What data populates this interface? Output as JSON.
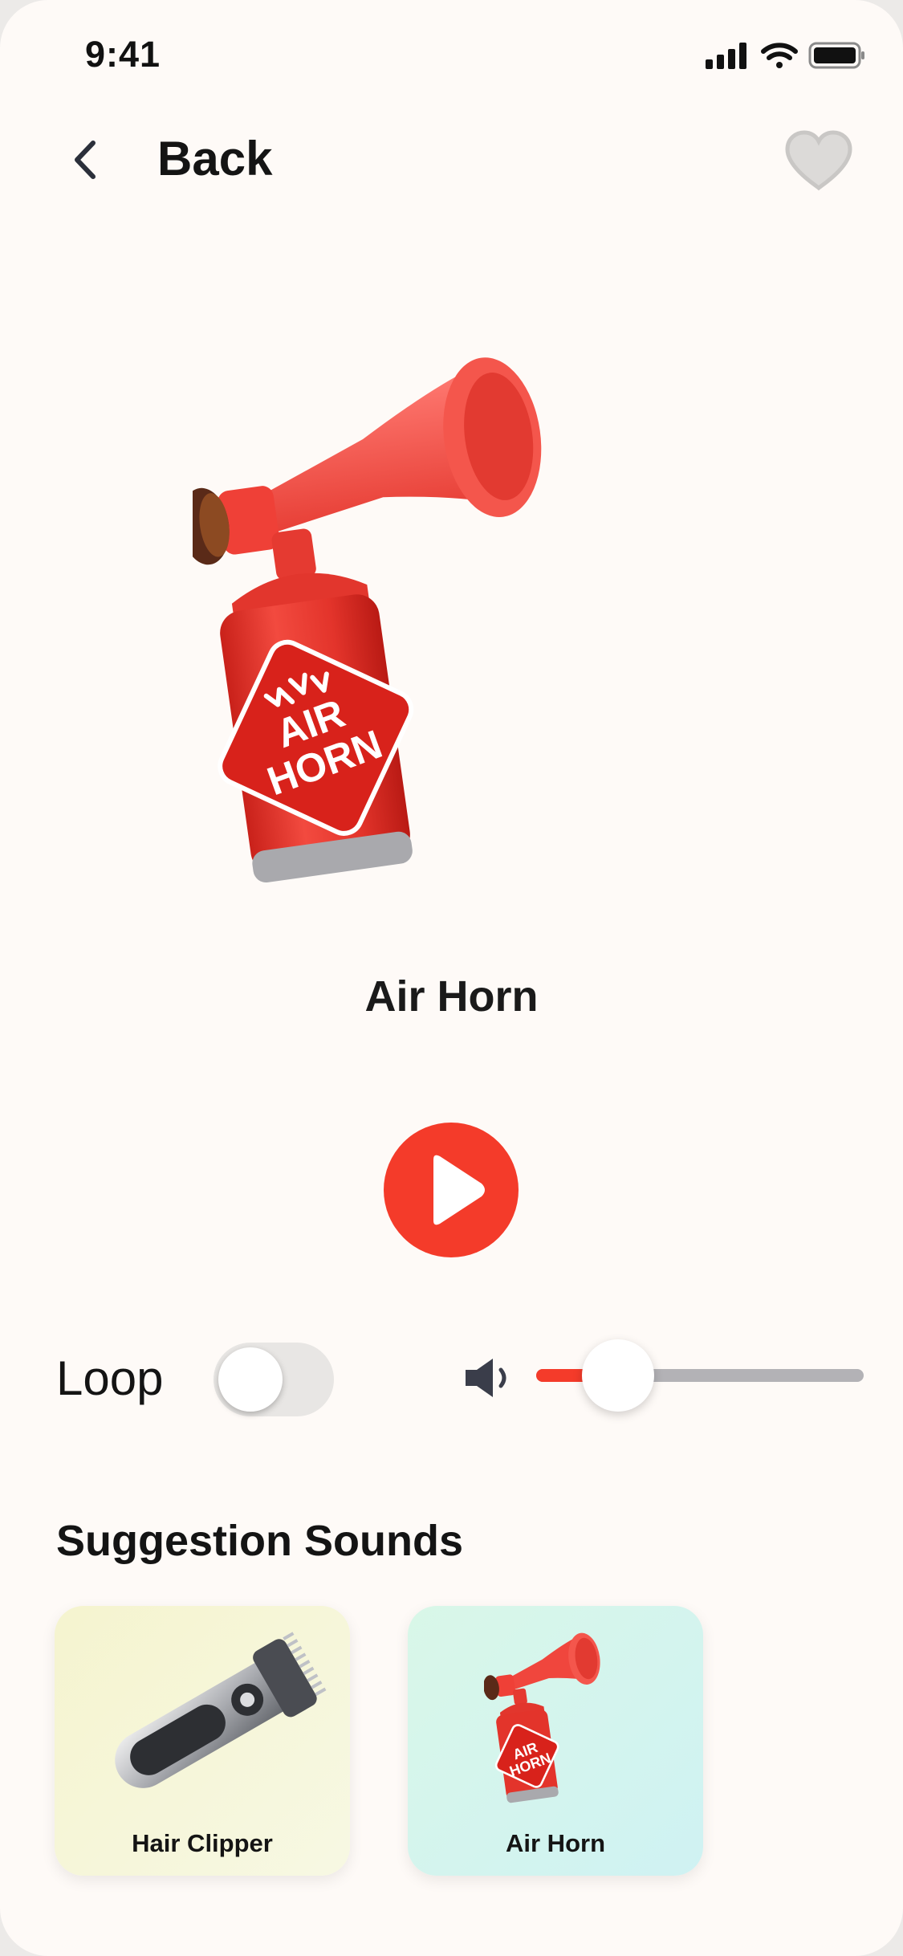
{
  "status": {
    "time": "9:41"
  },
  "header": {
    "back_label": "Back"
  },
  "hero": {
    "can_text_line1": "AIR",
    "can_text_line2": "HORN"
  },
  "sound": {
    "title": "Air Horn"
  },
  "controls": {
    "loop_label": "Loop",
    "loop_on": false,
    "volume": 0.25
  },
  "suggestions": {
    "title": "Suggestion Sounds",
    "items": [
      {
        "label": "Hair Clipper",
        "icon": "hair-clipper-icon"
      },
      {
        "label": "Air Horn",
        "icon": "air-horn-icon",
        "can_text_line1": "AIR",
        "can_text_line2": "HORN"
      }
    ]
  },
  "colors": {
    "accent": "#f43b2a",
    "background": "#fefaf7",
    "track": "#b3b2b6"
  }
}
